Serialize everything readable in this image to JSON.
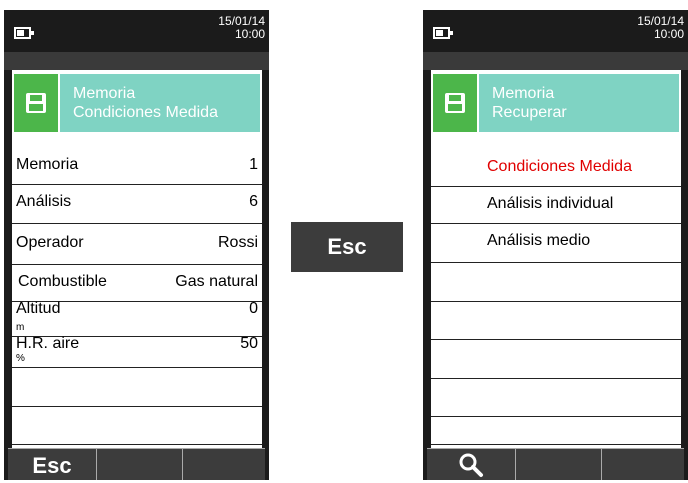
{
  "left_screen": {
    "date": "15/01/14",
    "time": "10:00",
    "header": {
      "line1": "Memoria",
      "line2": "Condiciones Medida",
      "icon": "floppy-disk-icon"
    },
    "rows": [
      {
        "label": "Memoria",
        "value": "1",
        "unit": ""
      },
      {
        "label": "Análisis",
        "value": "6",
        "unit": ""
      },
      {
        "label": "Operador",
        "value": "Rossi",
        "unit": ""
      },
      {
        "label": "Combustible",
        "value": "Gas natural",
        "unit": ""
      },
      {
        "label": "Altitud",
        "value": "0",
        "unit": "m"
      },
      {
        "label": "H.R. aire",
        "value": "50",
        "unit": "%"
      }
    ],
    "softkeys": {
      "key1": "Esc",
      "key2": "",
      "key3": ""
    }
  },
  "center_button": {
    "label": "Esc"
  },
  "right_screen": {
    "date": "15/01/14",
    "time": "10:00",
    "header": {
      "line1": "Memoria",
      "line2": "Recuperar",
      "icon": "floppy-disk-icon"
    },
    "items": [
      {
        "label": "Condiciones Medida",
        "selected": true
      },
      {
        "label": "Análisis individual",
        "selected": false
      },
      {
        "label": "Análisis medio",
        "selected": false
      }
    ],
    "softkeys": {
      "key1_icon": "search-icon",
      "key2": "",
      "key3": ""
    }
  },
  "colors": {
    "accent_green": "#4cb64a",
    "header_teal": "#7fd3c3",
    "selected_red": "#e00000",
    "device_dark": "#1b1b1b"
  }
}
